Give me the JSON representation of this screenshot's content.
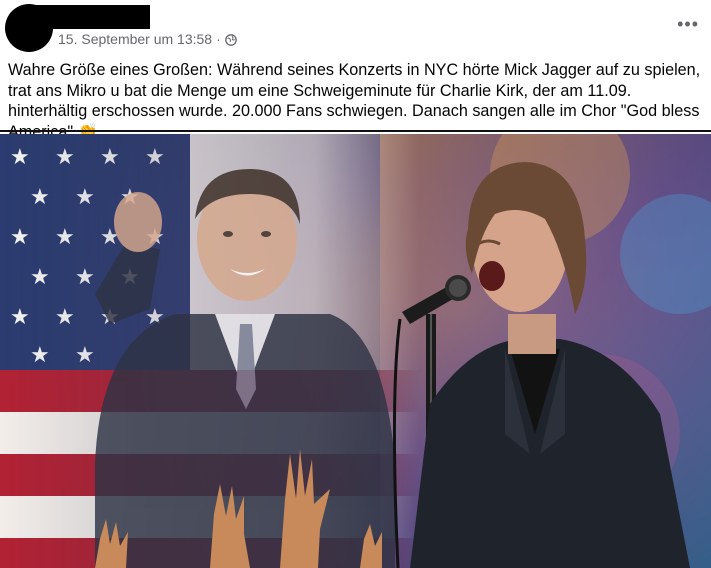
{
  "post": {
    "timestamp": "15. September um 13:58",
    "separator": "·",
    "more_label": "•••",
    "text": "Wahre Größe eines Großen: Während seines Konzerts in NYC hörte Mick Jagger auf zu spielen, trat ans Mikro u bat die Menge um eine Schweigeminute für Charlie Kirk, der am 11.09. hinterhältig erschossen wurde. 20.000 Fans schwiegen. Danach sangen alle im Chor \"God bless America\" 👏"
  },
  "icons": {
    "audience": "globe-icon",
    "more": "more-options-icon"
  }
}
